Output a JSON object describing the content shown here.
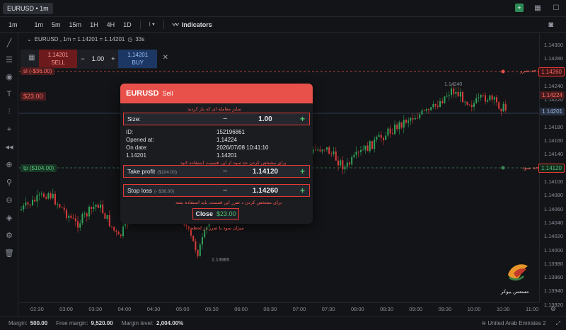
{
  "topbar": {
    "symbol_tab": "EURUSD • 1m",
    "icons": [
      "plus-icon",
      "grid-icon",
      "square-icon"
    ]
  },
  "timeframes": [
    "1m",
    "1m",
    "5m",
    "15m",
    "1H",
    "4H",
    "1D"
  ],
  "indicators_label": "Indicators",
  "info_line": {
    "text": "EURUSD , 1m = 1.14201 = 1.14201",
    "timer": "33s"
  },
  "quick_trade": {
    "sell_price": "1.14201",
    "sell_label": "SELL",
    "volume": "1.00",
    "buy_price": "1.14201",
    "buy_label": "BUY"
  },
  "chart_tags": {
    "sl": "sl (-$36.00)",
    "tp": "tp ($104.00)",
    "pnl": "$23.00"
  },
  "price_axis": {
    "labels": [
      "1.14300",
      "1.14280",
      "1.14260",
      "1.14240",
      "1.14220",
      "1.14200",
      "1.14180",
      "1.14160",
      "1.14140",
      "1.14120",
      "1.14100",
      "1.14080",
      "1.14060",
      "1.14040",
      "1.14020",
      "1.14000",
      "1.13980",
      "1.13960",
      "1.13940",
      "1.13920"
    ],
    "sl_box": "1.14260",
    "current_box": "1.14224",
    "bid_box": "1.14201",
    "tp_box": "1.14120"
  },
  "annotations": {
    "sl_side": "حد ضرر",
    "tp_side": "حد سود",
    "size_note": "سایز معامله ای که باز کردید",
    "tp_note": "برای مشخص کردن حد سود از این قسمت استفاده کنید",
    "sl_note": "برای مشخص کردن د ضرر این قسمت باید استفاده بشه",
    "pnl_note": "میزان سود یا ضرر در لحظه"
  },
  "time_axis": [
    "02:30",
    "03:00",
    "03:30",
    "04:00",
    "04:30",
    "05:00",
    "05:30",
    "06:00",
    "06:30",
    "07:00",
    "07:30",
    "08:00",
    "08:30",
    "09:00",
    "09:30",
    "10:00",
    "10:30",
    "11:00"
  ],
  "extremes": {
    "low": "1.13985",
    "high": "1.14240"
  },
  "dialog": {
    "symbol": "EURUSD",
    "side": "Sell",
    "size_label": "Size:",
    "size_value": "1.00",
    "id_label": "ID:",
    "id_value": "152196861",
    "opened_at_label": "Opened at:",
    "opened_at_value": "1.14224",
    "on_date_label": "On date:",
    "on_date_value": "2026/07/08 10:41:10",
    "current_left": "1.14201",
    "current_right": "1.14201",
    "tp_label": "Take profit",
    "tp_sub": "($104.00)",
    "tp_value": "1.14120",
    "sl_label": "Stop loss",
    "sl_sub": "(- $36.00)",
    "sl_value": "1.14260",
    "close_label": "Close",
    "close_amount": "$23.00"
  },
  "status": {
    "margin_label": "Margin:",
    "margin_value": "500.00",
    "free_margin_label": "Free margin:",
    "free_margin_value": "9,520.00",
    "margin_level_label": "Margin level:",
    "margin_level_value": "2,004.00%",
    "region": "United Arab Emirates 2"
  },
  "logo_text": "مسعس بیوکر",
  "colors": {
    "sell": "#e8514a",
    "buy_profit": "#4cc470",
    "highlight": "#e53935",
    "background": "#131417"
  }
}
